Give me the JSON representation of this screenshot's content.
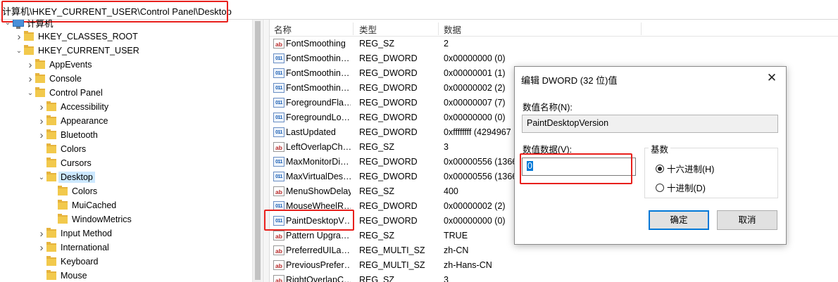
{
  "address": {
    "path": "计算机\\HKEY_CURRENT_USER\\Control Panel\\Desktop"
  },
  "tree": {
    "items": [
      {
        "label": "计算机",
        "icon": "computer-icon",
        "expanded": true,
        "selected": false
      },
      {
        "label": "HKEY_CLASSES_ROOT",
        "icon": "folder-icon",
        "expanded": false,
        "selected": false
      },
      {
        "label": "HKEY_CURRENT_USER",
        "icon": "folder-icon",
        "expanded": true,
        "selected": false
      },
      {
        "label": "AppEvents",
        "icon": "folder-icon",
        "expanded": false,
        "selected": false
      },
      {
        "label": "Console",
        "icon": "folder-icon",
        "expanded": false,
        "selected": false
      },
      {
        "label": "Control Panel",
        "icon": "folder-icon",
        "expanded": true,
        "selected": false
      },
      {
        "label": "Accessibility",
        "icon": "folder-icon",
        "expanded": false,
        "selected": false
      },
      {
        "label": "Appearance",
        "icon": "folder-icon",
        "expanded": false,
        "selected": false
      },
      {
        "label": "Bluetooth",
        "icon": "folder-icon",
        "expanded": false,
        "selected": false
      },
      {
        "label": "Colors",
        "icon": "folder-icon",
        "expanded": false,
        "selected": false
      },
      {
        "label": "Cursors",
        "icon": "folder-icon",
        "expanded": false,
        "selected": false
      },
      {
        "label": "Desktop",
        "icon": "folder-icon",
        "expanded": true,
        "selected": true
      },
      {
        "label": "Colors",
        "icon": "folder-icon",
        "expanded": false,
        "selected": false
      },
      {
        "label": "MuiCached",
        "icon": "folder-icon",
        "expanded": false,
        "selected": false
      },
      {
        "label": "WindowMetrics",
        "icon": "folder-icon",
        "expanded": false,
        "selected": false
      },
      {
        "label": "Input Method",
        "icon": "folder-icon",
        "expanded": false,
        "selected": false
      },
      {
        "label": "International",
        "icon": "folder-icon",
        "expanded": false,
        "selected": false
      },
      {
        "label": "Keyboard",
        "icon": "folder-icon",
        "expanded": false,
        "selected": false
      },
      {
        "label": "Mouse",
        "icon": "folder-icon",
        "expanded": false,
        "selected": false
      }
    ]
  },
  "list": {
    "columns": {
      "name": "名称",
      "type": "类型",
      "data": "数据"
    },
    "rows": [
      {
        "name": "FontSmoothing",
        "type": "REG_SZ",
        "data": "2",
        "kind": "sz"
      },
      {
        "name": "FontSmoothin…",
        "type": "REG_DWORD",
        "data": "0x00000000 (0)",
        "kind": "dword"
      },
      {
        "name": "FontSmoothin…",
        "type": "REG_DWORD",
        "data": "0x00000001 (1)",
        "kind": "dword"
      },
      {
        "name": "FontSmoothin…",
        "type": "REG_DWORD",
        "data": "0x00000002 (2)",
        "kind": "dword"
      },
      {
        "name": "ForegroundFla…",
        "type": "REG_DWORD",
        "data": "0x00000007 (7)",
        "kind": "dword"
      },
      {
        "name": "ForegroundLo…",
        "type": "REG_DWORD",
        "data": "0x00000000 (0)",
        "kind": "dword"
      },
      {
        "name": "LastUpdated",
        "type": "REG_DWORD",
        "data": "0xffffffff (4294967",
        "kind": "dword"
      },
      {
        "name": "LeftOverlapCh…",
        "type": "REG_SZ",
        "data": "3",
        "kind": "sz"
      },
      {
        "name": "MaxMonitorDi…",
        "type": "REG_DWORD",
        "data": "0x00000556 (1366",
        "kind": "dword"
      },
      {
        "name": "MaxVirtualDes…",
        "type": "REG_DWORD",
        "data": "0x00000556 (1366",
        "kind": "dword"
      },
      {
        "name": "MenuShowDelay",
        "type": "REG_SZ",
        "data": "400",
        "kind": "sz"
      },
      {
        "name": "MouseWheelR…",
        "type": "REG_DWORD",
        "data": "0x00000002 (2)",
        "kind": "dword"
      },
      {
        "name": "PaintDesktopV…",
        "type": "REG_DWORD",
        "data": "0x00000000 (0)",
        "kind": "dword"
      },
      {
        "name": "Pattern Upgra…",
        "type": "REG_SZ",
        "data": "TRUE",
        "kind": "sz"
      },
      {
        "name": "PreferredUILa…",
        "type": "REG_MULTI_SZ",
        "data": "zh-CN",
        "kind": "sz"
      },
      {
        "name": "PreviousPrefer…",
        "type": "REG_MULTI_SZ",
        "data": "zh-Hans-CN",
        "kind": "sz"
      },
      {
        "name": "RightOverlapC…",
        "type": "REG_SZ",
        "data": "3",
        "kind": "sz"
      }
    ]
  },
  "dialog": {
    "title": "编辑 DWORD (32 位)值",
    "close_glyph": "✕",
    "name_label": "数值名称(N):",
    "name_value": "PaintDesktopVersion",
    "data_label": "数值数据(V):",
    "data_value": "0",
    "base_label": "基数",
    "radio_hex": "十六进制(H)",
    "radio_dec": "十进制(D)",
    "selected_base": "hex",
    "ok": "确定",
    "cancel": "取消"
  },
  "icons": {
    "sz": "ab",
    "dword": "011"
  },
  "colors": {
    "highlight": "#e8201c",
    "selection": "#cce8ff",
    "accent": "#0078d7"
  }
}
